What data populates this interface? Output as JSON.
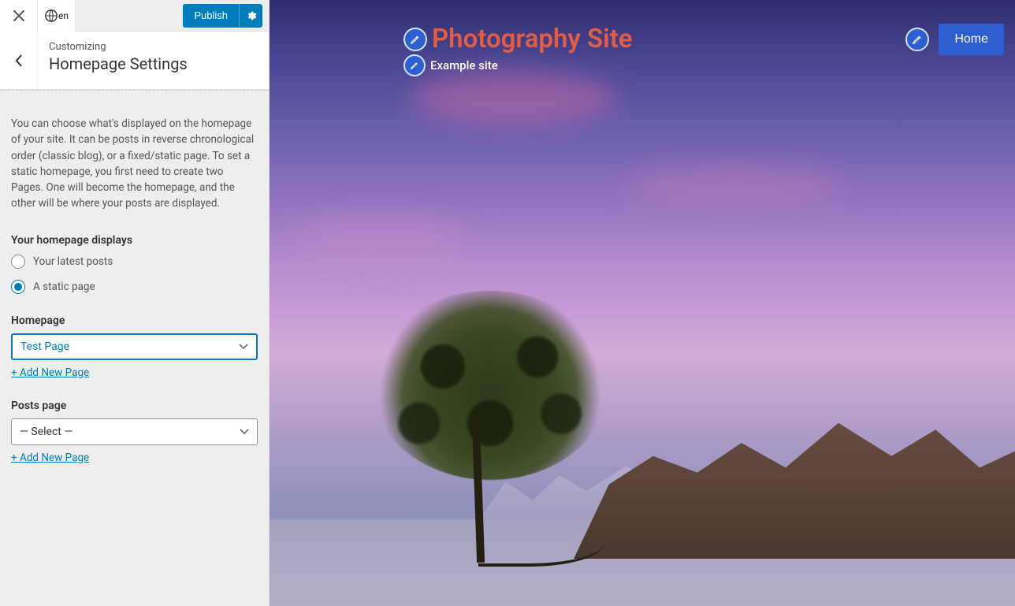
{
  "top": {
    "lang_code": "en",
    "publish_label": "Publish"
  },
  "header": {
    "subtitle": "Customizing",
    "title": "Homepage Settings"
  },
  "panel": {
    "description": "You can choose what's displayed on the homepage of your site. It can be posts in reverse chronological order (classic blog), or a fixed/static page. To set a static homepage, you first need to create two Pages. One will become the homepage, and the other will be where your posts are displayed.",
    "displays_label": "Your homepage displays",
    "radio_latest": "Your latest posts",
    "radio_static": "A static page",
    "homepage_label": "Homepage",
    "homepage_selected": "Test Page",
    "posts_page_label": "Posts page",
    "posts_page_selected": "— Select —",
    "add_new_label": "+ Add New Page"
  },
  "preview": {
    "site_title": "Photography Site",
    "tagline": "Example site",
    "nav_home": "Home"
  }
}
